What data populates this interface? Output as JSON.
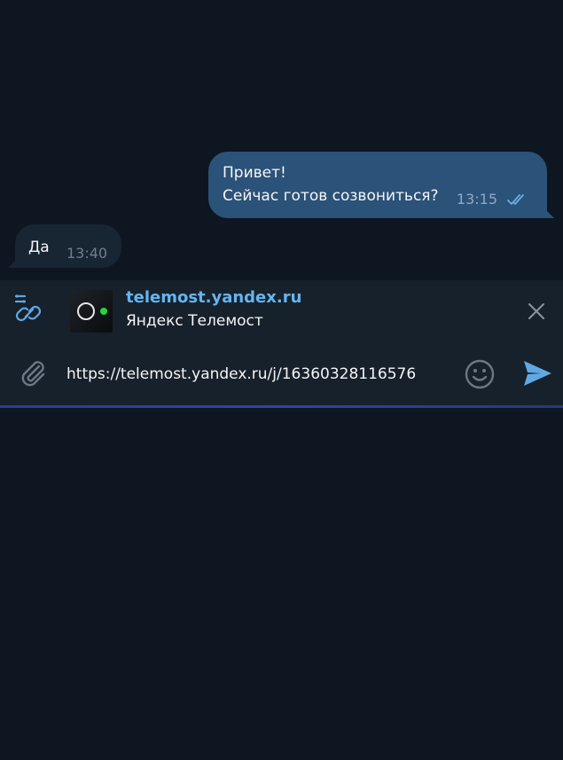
{
  "messages": [
    {
      "direction": "outgoing",
      "lines": [
        "Привет!",
        "Сейчас готов созвониться?"
      ],
      "time": "13:15",
      "status": "read"
    },
    {
      "direction": "incoming",
      "text": "Да",
      "time": "13:40"
    }
  ],
  "link_preview": {
    "domain": "telemost.yandex.ru",
    "title": "Яндекс Телемост"
  },
  "composer": {
    "value": "https://telemost.yandex.ru/j/16360328116576"
  },
  "colors": {
    "background": "#0e1621",
    "outgoing_bubble": "#2b5278",
    "incoming_bubble": "#182533",
    "composer": "#17212b",
    "accent": "#64b5ef"
  },
  "upload_progress": 1.0
}
